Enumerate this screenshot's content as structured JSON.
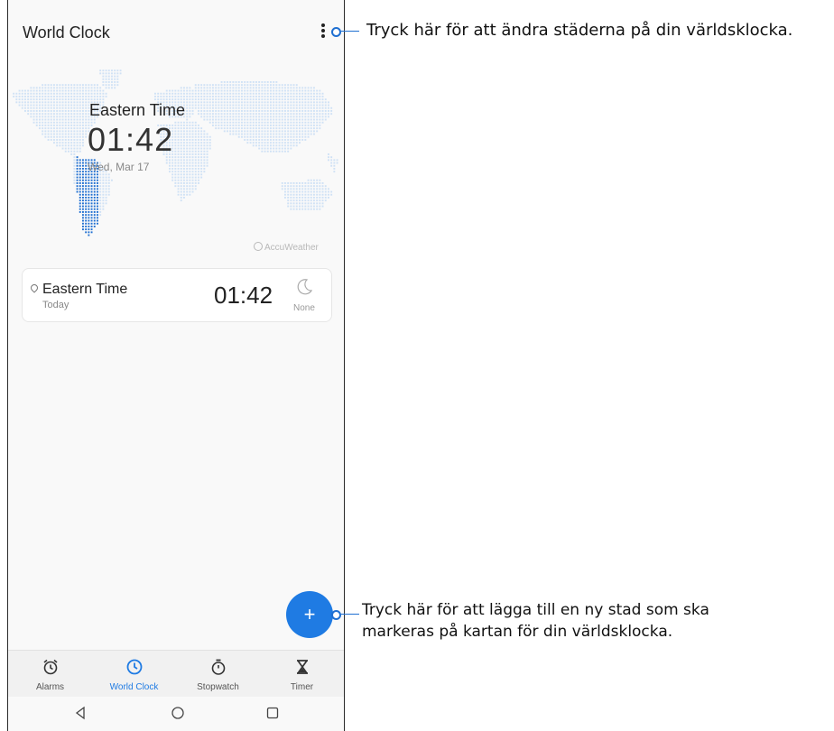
{
  "app": {
    "title": "World Clock"
  },
  "map": {
    "city": "Eastern Time",
    "time": "01:42",
    "date": "Wed, Mar 17",
    "provider": "AccuWeather"
  },
  "card": {
    "city": "Eastern Time",
    "day": "Today",
    "time": "01:42",
    "weather": "None"
  },
  "nav": {
    "tabs": [
      {
        "label": "Alarms",
        "icon": "alarm-icon"
      },
      {
        "label": "World Clock",
        "icon": "clock-icon"
      },
      {
        "label": "Stopwatch",
        "icon": "stopwatch-icon"
      },
      {
        "label": "Timer",
        "icon": "hourglass-icon"
      }
    ],
    "active": "World Clock"
  },
  "fab": {
    "symbol": "+"
  },
  "callouts": {
    "menu": "Tryck här för att ändra städerna på din världsklocka.",
    "add_line1": "Tryck här för att lägga till en ny stad som ska",
    "add_line2": "markeras på kartan för din världsklocka."
  },
  "colors": {
    "accent": "#1f7be3",
    "callout_line": "#1f6fd1"
  }
}
